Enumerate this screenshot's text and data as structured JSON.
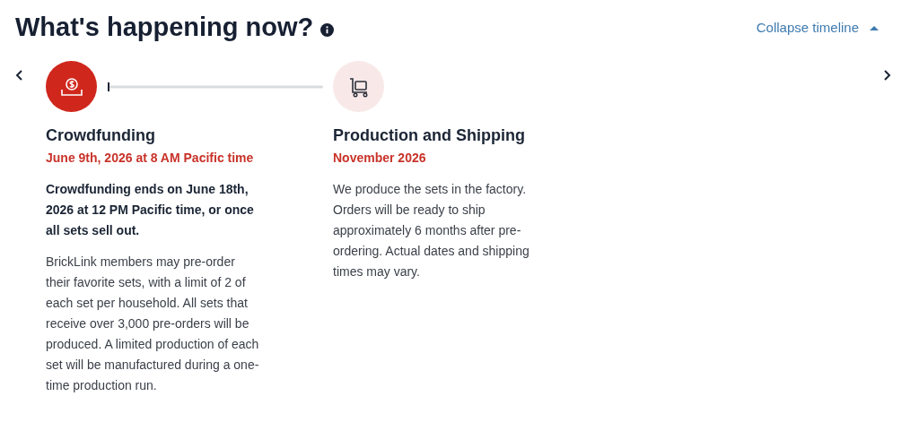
{
  "heading": {
    "title": "What's happening now?"
  },
  "collapse_link": {
    "label": "Collapse timeline",
    "expanded": true
  },
  "steps": [
    {
      "title": "Crowdfunding",
      "date": "June 9th, 2026 at 8 AM Pacific time",
      "active": true,
      "note": "Crowdfunding ends on June 18th, 2026 at 12 PM Pacific time, or once all sets sell out.",
      "description": "BrickLink members may pre-order their favorite sets, with a limit of 2 of each set per household. All sets that receive over 3,000 pre-orders will be produced. A limited production of each set will be manufactured during a one-time production run."
    },
    {
      "title": "Production and Shipping",
      "date": "November 2026",
      "active": false,
      "description": "We produce the sets in the factory. Orders will be ready to ship approximately 6 months after pre-ordering. Actual dates and shipping times may vary."
    }
  ]
}
